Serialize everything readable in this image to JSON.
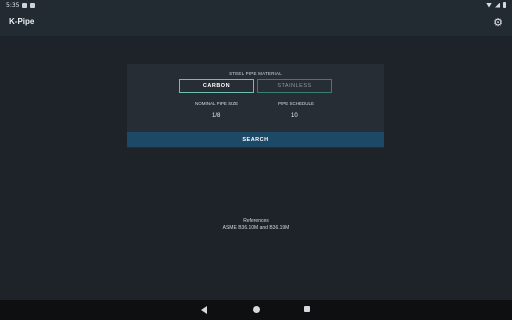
{
  "status": {
    "time": "5:35"
  },
  "app": {
    "title": "K-Pipe",
    "settings_icon": "gear-icon"
  },
  "form": {
    "material_label": "STEEL PIPE MATERIAL",
    "options": [
      "CARBON",
      "STAINLESS"
    ],
    "selected": "CARBON",
    "size_label": "NOMINAL PIPE SIZE",
    "size_value": "1/8",
    "schedule_label": "PIPE SCHEDULE",
    "schedule_value": "10",
    "search_label": "SEARCH"
  },
  "references": {
    "title": "References",
    "text": "ASME B36.10M and B36.19M"
  },
  "navbar": {
    "back": "back-icon",
    "home": "home-icon",
    "recent": "recent-apps-icon"
  },
  "colors": {
    "accent": "#3f8f86",
    "search_bg": "#1b4966",
    "background": "#1d2329"
  }
}
